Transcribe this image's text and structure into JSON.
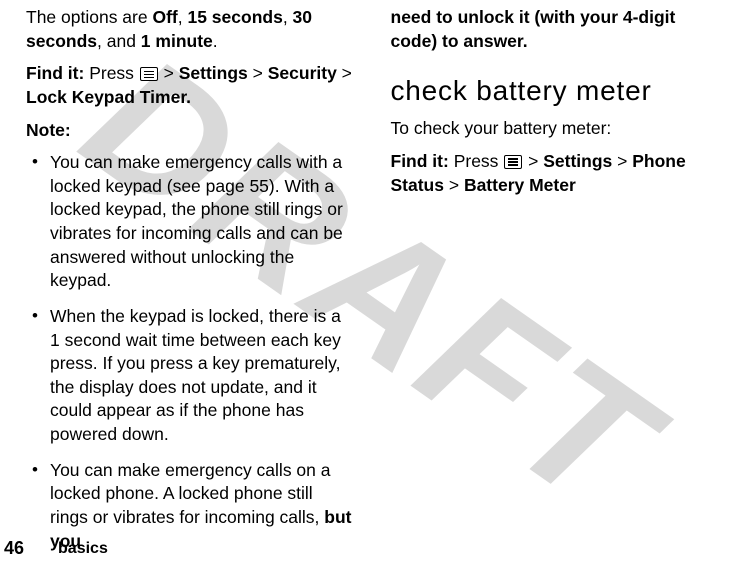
{
  "watermark": "DRAFT",
  "left": {
    "options_intro": "The options are ",
    "opt_off": "Off",
    "sep": ", ",
    "opt_15": "15 seconds",
    "opt_30": "30 seconds",
    "and": ", and ",
    "opt_1m": "1 minute",
    "period": ".",
    "find_label": "Find it: ",
    "find_press": "Press ",
    "gt": " > ",
    "path_settings": "Settings",
    "path_security": "Security",
    "path_lock": "Lock Keypad Timer.",
    "note_label": "Note:",
    "bullets": [
      "You can make emergency calls with a locked keypad (see page 55). With a locked keypad, the phone still rings or vibrates for incoming calls and can be answered without unlocking the keypad.",
      "When the keypad is locked, there is a 1 second wait time between each key press. If you press a key prematurely, the display does not update, and it could appear as if the phone has powered down.",
      {
        "pre": "You can make emergency calls on a locked phone. A locked phone still rings or vibrates for incoming calls, ",
        "bold": "but you"
      }
    ]
  },
  "right": {
    "cont_bold": "need to unlock it (with your 4-digit code) to answer.",
    "heading": "check battery meter",
    "intro": "To check your battery meter:",
    "find_label": "Find it: ",
    "find_press": "Press ",
    "gt": " > ",
    "path_settings": "Settings",
    "path_phone_status": "Phone Status",
    "path_battery": "Battery Meter"
  },
  "footer": {
    "page": "46",
    "section": "basics"
  }
}
